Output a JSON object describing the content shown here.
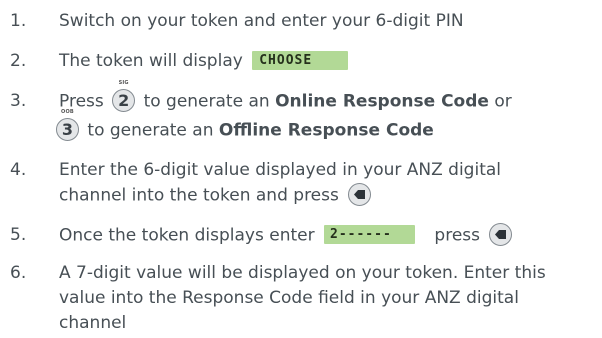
{
  "steps": [
    {
      "number": "1.",
      "text": "Switch on your token and enter your 6-digit PIN"
    },
    {
      "number": "2.",
      "pre": "The token will display",
      "display": "CHOOSE"
    },
    {
      "number": "3.",
      "pre1": "Press",
      "key1": {
        "cap": "SIG",
        "label": "2"
      },
      "mid1": "to generate an",
      "bold1": "Online Response Code",
      "post1": "or",
      "key2": {
        "cap": "OOB",
        "label": "3"
      },
      "mid2": "to generate an",
      "bold2": "Offline Response Code"
    },
    {
      "number": "4.",
      "line1": "Enter the 6-digit value displayed in your ANZ digital",
      "line2": "channel into the token and press",
      "enter_key": "enter-key-icon"
    },
    {
      "number": "5.",
      "pre": "Once the token displays enter",
      "display": "2------",
      "post": "press",
      "enter_key": "enter-key-icon"
    },
    {
      "number": "6.",
      "line1": "A 7-digit value will be displayed on your token. Enter this",
      "line2": "value into the Response Code field in your ANZ digital",
      "line3": "channel"
    }
  ],
  "colors": {
    "text": "#474f55",
    "lcd_background": "#b2d996",
    "lcd_text": "#25301c",
    "key_border": "#838a90",
    "key_fill": "#e4e6e8"
  }
}
